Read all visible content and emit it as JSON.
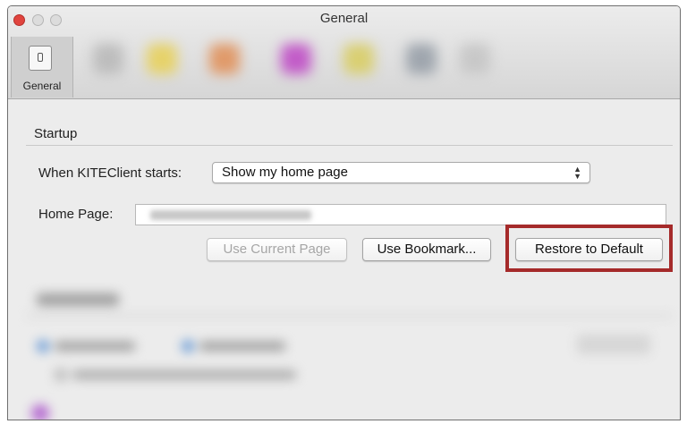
{
  "window": {
    "title": "General"
  },
  "toolbar": {
    "general_label": "General"
  },
  "startup": {
    "section_title": "Startup",
    "when_label": "When KITEClient starts:",
    "when_value": "Show my home page",
    "home_page_label": "Home Page:",
    "home_page_value": ""
  },
  "buttons": {
    "use_current_page": "Use Current Page",
    "use_bookmark": "Use Bookmark...",
    "restore_default": "Restore to Default"
  },
  "colors": {
    "highlight": "#a52a2a",
    "close_button": "#e0443e",
    "window_bg": "#ececec"
  },
  "icons": {
    "general": "light-switch-icon",
    "select_arrows": "up-down-arrows-icon"
  }
}
